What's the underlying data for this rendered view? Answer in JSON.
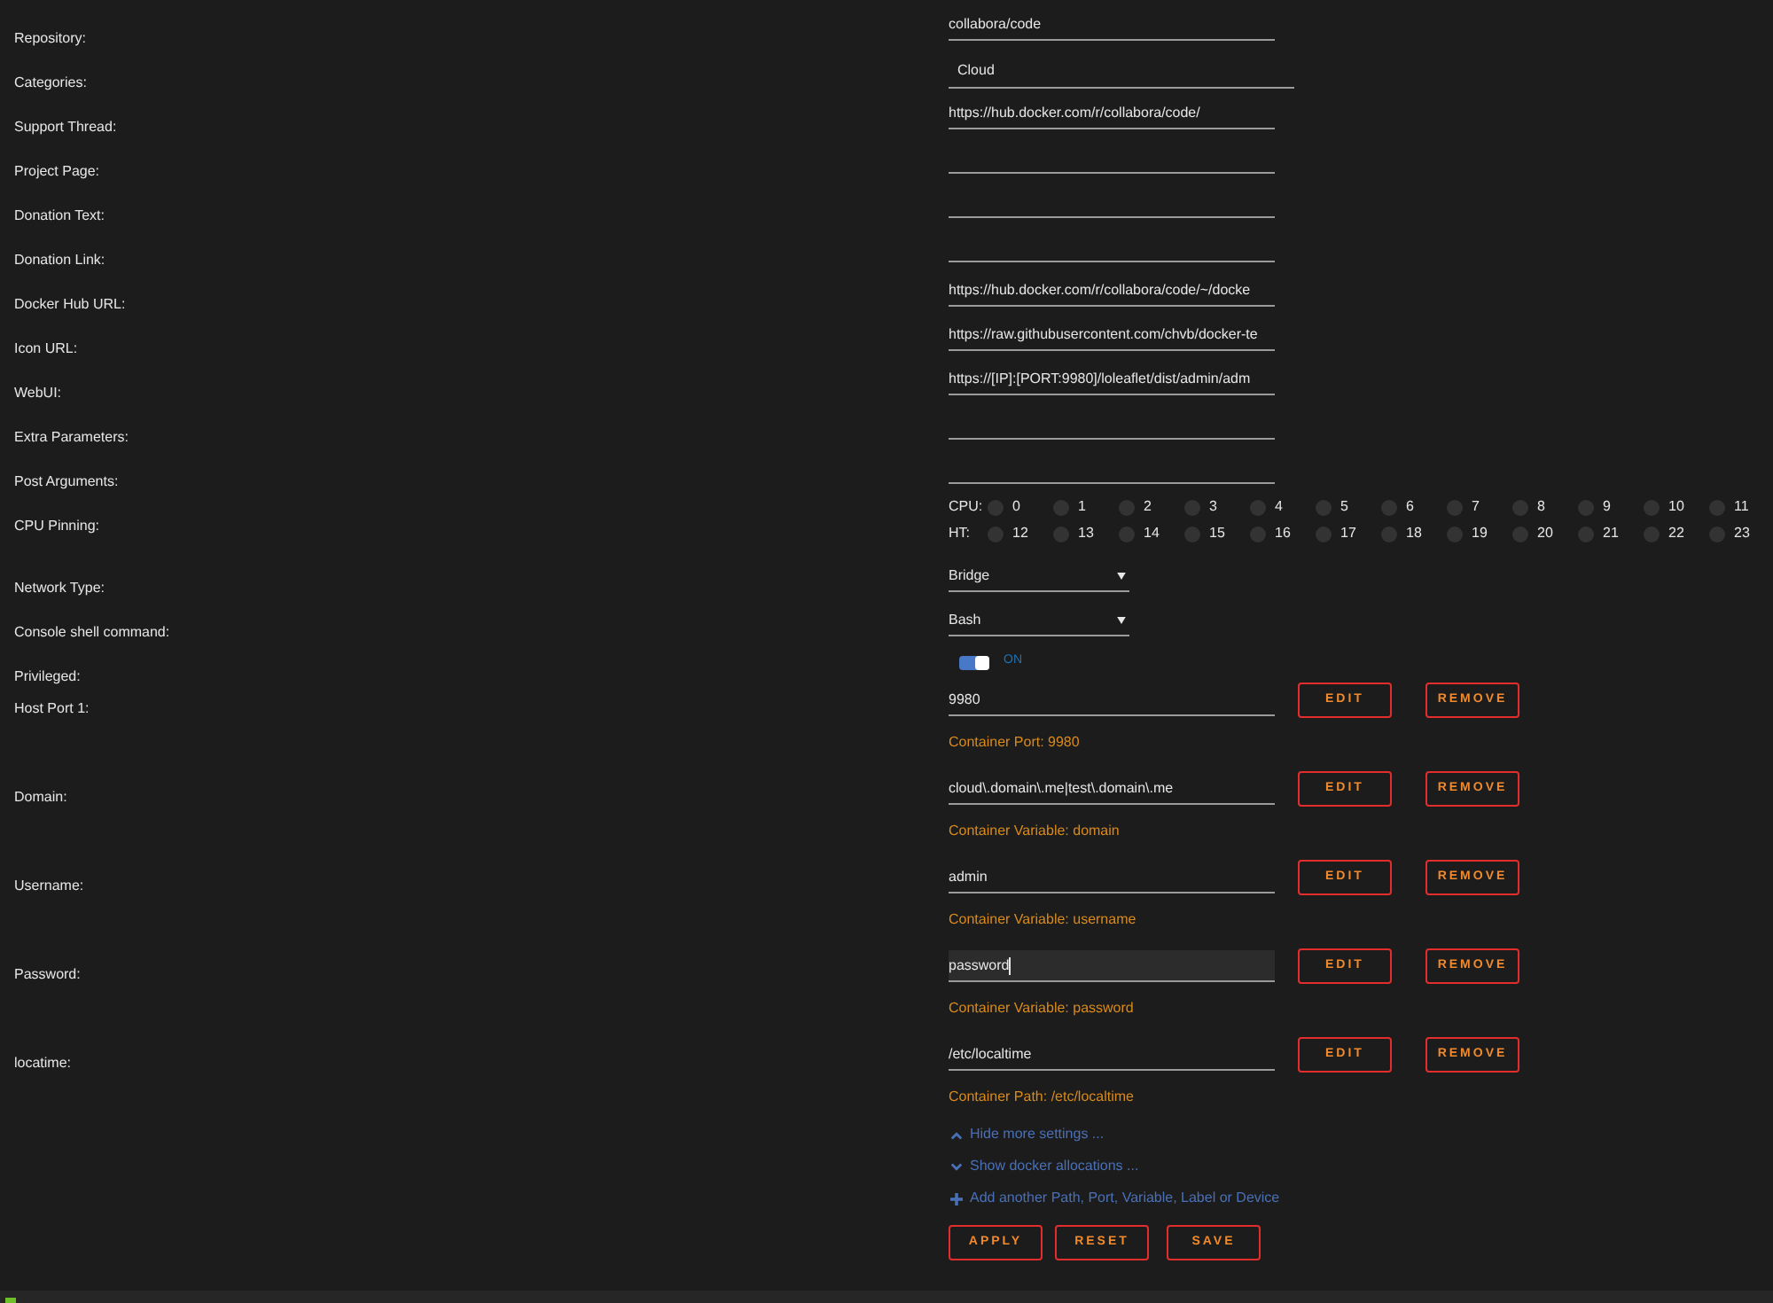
{
  "settings": [
    {
      "label": "Repository:",
      "kind": "text",
      "value": "collabora/code"
    },
    {
      "label": "Categories:",
      "kind": "category",
      "value": "Cloud"
    },
    {
      "label": "Support Thread:",
      "kind": "text",
      "value": "https://hub.docker.com/r/collabora/code/"
    },
    {
      "label": "Project Page:",
      "kind": "text"
    },
    {
      "label": "Donation Text:",
      "kind": "text"
    },
    {
      "label": "Donation Link:",
      "kind": "text"
    },
    {
      "label": "Docker Hub URL:",
      "kind": "text",
      "value": "https://hub.docker.com/r/collabora/code/~/docke"
    },
    {
      "label": "Icon URL:",
      "kind": "text",
      "value": "https://raw.githubusercontent.com/chvb/docker-te"
    },
    {
      "label": "WebUI:",
      "kind": "text",
      "value": "https://[IP]:[PORT:9980]/loleaflet/dist/admin/adm"
    },
    {
      "label": "Extra Parameters:",
      "kind": "text"
    },
    {
      "label": "Post Arguments:",
      "kind": "text"
    }
  ],
  "cpu_pinning": {
    "label": "CPU Pinning:",
    "rows": [
      {
        "label": "CPU:",
        "cores": [
          {
            "number": "0",
            "checked": false
          },
          {
            "number": "1",
            "checked": false
          },
          {
            "number": "2",
            "checked": false
          },
          {
            "number": "3",
            "checked": false
          },
          {
            "number": "4",
            "checked": false
          },
          {
            "number": "5",
            "checked": false
          },
          {
            "number": "6",
            "checked": false
          },
          {
            "number": "7",
            "checked": false
          },
          {
            "number": "8",
            "checked": false
          },
          {
            "number": "9",
            "checked": false
          },
          {
            "number": "10",
            "checked": false
          },
          {
            "number": "11",
            "checked": false
          }
        ]
      },
      {
        "label": "HT:",
        "cores": [
          {
            "number": "12",
            "checked": false
          },
          {
            "number": "13",
            "checked": false
          },
          {
            "number": "14",
            "checked": false
          },
          {
            "number": "15",
            "checked": false
          },
          {
            "number": "16",
            "checked": false
          },
          {
            "number": "17",
            "checked": false
          },
          {
            "number": "18",
            "checked": false
          },
          {
            "number": "19",
            "checked": false
          },
          {
            "number": "20",
            "checked": false
          },
          {
            "number": "21",
            "checked": false
          },
          {
            "number": "22",
            "checked": false
          },
          {
            "number": "23",
            "checked": false
          }
        ]
      }
    ]
  },
  "selects": [
    {
      "label": "Network Type:",
      "value": "Bridge"
    },
    {
      "label": "Console shell command:",
      "value": "Bash"
    }
  ],
  "privileged": {
    "label": "Privileged:",
    "on": true,
    "state_text": "ON"
  },
  "config_items": [
    {
      "label": "Host Port 1:",
      "value": "9980",
      "focused": false,
      "buttons": [
        "EDIT",
        "REMOVE"
      ],
      "description": "Container Port: 9980"
    },
    {
      "label": "Domain:",
      "value": "cloud\\.domain\\.me|test\\.domain\\.me",
      "focused": false,
      "buttons": [
        "EDIT",
        "REMOVE"
      ],
      "description": "Container Variable: domain"
    },
    {
      "label": "Username:",
      "value": "admin",
      "focused": false,
      "buttons": [
        "EDIT",
        "REMOVE"
      ],
      "description": "Container Variable: username"
    },
    {
      "label": "Password:",
      "value": "password",
      "focused": true,
      "buttons": [
        "EDIT",
        "REMOVE"
      ],
      "description": "Container Variable: password"
    },
    {
      "label": "locatime:",
      "value": "/etc/localtime",
      "focused": false,
      "buttons": [
        "EDIT",
        "REMOVE"
      ],
      "description": "Container Path: /etc/localtime"
    }
  ],
  "links": [
    {
      "kind": "collapse",
      "text": "Hide more settings ..."
    },
    {
      "kind": "expand",
      "text": "Show docker allocations ..."
    },
    {
      "kind": "add",
      "text": "Add another Path, Port, Variable, Label or Device"
    }
  ],
  "actions": [
    "APPLY",
    "RESET",
    "SAVE"
  ]
}
